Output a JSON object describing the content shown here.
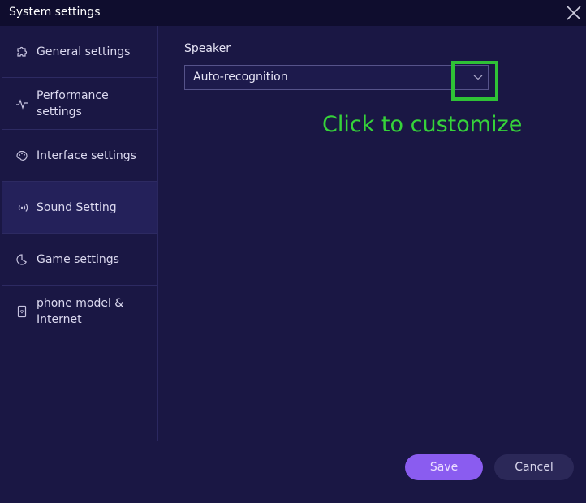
{
  "window": {
    "title": "System settings"
  },
  "sidebar": {
    "items": [
      {
        "label": "General settings",
        "icon": "puzzle-icon"
      },
      {
        "label": "Performance settings",
        "icon": "pulse-icon"
      },
      {
        "label": "Interface settings",
        "icon": "palette-icon"
      },
      {
        "label": "Sound Setting",
        "icon": "sound-waves-icon",
        "active": true
      },
      {
        "label": "Game settings",
        "icon": "pie-icon"
      },
      {
        "label": "phone model & Internet",
        "icon": "device-icon"
      }
    ]
  },
  "main": {
    "speaker_label": "Speaker",
    "speaker_value": "Auto-recognition",
    "annotation": "Click to customize"
  },
  "footer": {
    "save_label": "Save",
    "cancel_label": "Cancel"
  },
  "colors": {
    "background": "#1a1744",
    "titlebar": "#0f0d2e",
    "accent": "#8a5cf0",
    "highlight": "#2fc236"
  }
}
